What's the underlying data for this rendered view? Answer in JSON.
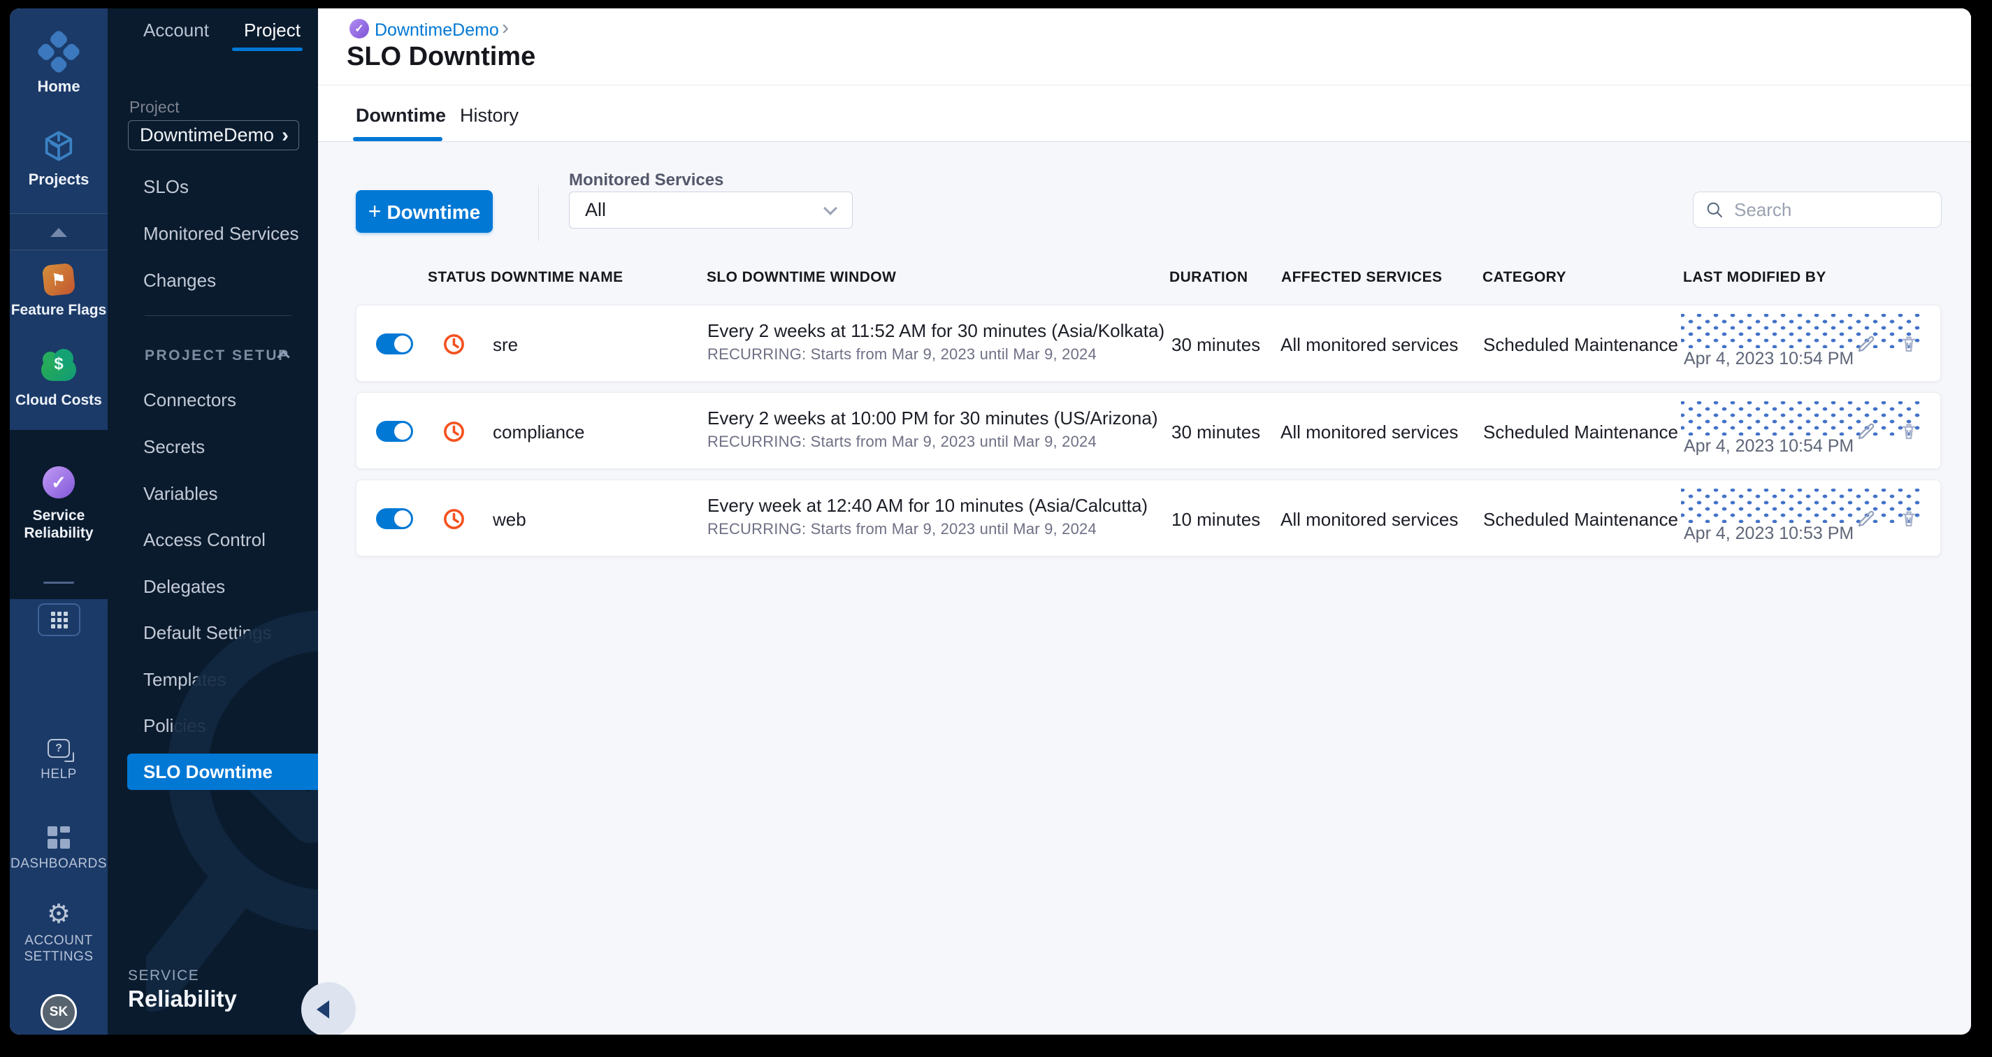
{
  "rail": {
    "top_items": [
      {
        "label": "Home"
      },
      {
        "label": "Projects"
      }
    ],
    "modules": [
      {
        "label": "Feature Flags"
      },
      {
        "label": "Cloud Costs"
      },
      {
        "label": "Service Reliability"
      }
    ],
    "bottom_items": [
      {
        "label": "HELP"
      },
      {
        "label": "DASHBOARDS"
      },
      {
        "label": "ACCOUNT SETTINGS"
      }
    ],
    "avatar_initials": "SK",
    "cloud_costs_symbol": "$",
    "flag_symbol": "⚑",
    "check_symbol": "✓",
    "help_symbol": "?",
    "gear_symbol": "⚙"
  },
  "sidebar": {
    "tabs": [
      {
        "label": "Account"
      },
      {
        "label": "Project"
      }
    ],
    "project_label": "Project",
    "project_value": "DowntimeDemo",
    "project_chevron": "›",
    "items": [
      {
        "label": "SLOs"
      },
      {
        "label": "Monitored Services"
      },
      {
        "label": "Changes"
      }
    ],
    "section_label": "PROJECT SETUP",
    "setup_items": [
      {
        "label": "Connectors"
      },
      {
        "label": "Secrets"
      },
      {
        "label": "Variables"
      },
      {
        "label": "Access Control"
      },
      {
        "label": "Delegates"
      },
      {
        "label": "Default Settings"
      },
      {
        "label": "Templates"
      },
      {
        "label": "Policies"
      },
      {
        "label": "SLO Downtime"
      }
    ],
    "footer_kicker": "SERVICE",
    "footer_name": "Reliability"
  },
  "header": {
    "breadcrumb_project": "DowntimeDemo",
    "breadcrumb_separator": "›",
    "breadcrumb_icon_glyph": "✓",
    "title": "SLO Downtime",
    "tabs": [
      {
        "label": "Downtime"
      },
      {
        "label": "History"
      }
    ]
  },
  "toolbar": {
    "plus": "+",
    "new_button_label": "Downtime",
    "filter_label": "Monitored Services",
    "filter_value": "All",
    "search_placeholder": "Search"
  },
  "table": {
    "columns": [
      "STATUS",
      "DOWNTIME NAME",
      "SLO DOWNTIME WINDOW",
      "DURATION",
      "AFFECTED SERVICES",
      "CATEGORY",
      "LAST MODIFIED BY"
    ],
    "rows": [
      {
        "enabled": true,
        "name": "sre",
        "window": "Every 2 weeks at 11:52 AM for 30 minutes (Asia/Kolkata)",
        "recurrence": "RECURRING: Starts from Mar 9, 2023 until Mar 9, 2024",
        "duration": "30 minutes",
        "affected": "All monitored services",
        "category": "Scheduled Maintenance",
        "modified": "Apr 4, 2023 10:54 PM"
      },
      {
        "enabled": true,
        "name": "compliance",
        "window": "Every 2 weeks at 10:00 PM for 30 minutes (US/Arizona)",
        "recurrence": "RECURRING: Starts from Mar 9, 2023 until Mar 9, 2024",
        "duration": "30 minutes",
        "affected": "All monitored services",
        "category": "Scheduled Maintenance",
        "modified": "Apr 4, 2023 10:54 PM"
      },
      {
        "enabled": true,
        "name": "web",
        "window": "Every week at 12:40 AM for 10 minutes (Asia/Calcutta)",
        "recurrence": "RECURRING: Starts from Mar 9, 2023 until Mar 9, 2024",
        "duration": "10 minutes",
        "affected": "All monitored services",
        "category": "Scheduled Maintenance",
        "modified": "Apr 4, 2023 10:53 PM"
      }
    ]
  },
  "colors": {
    "accent": "#0278d5",
    "rail_bg": "#1b3a68",
    "sidebar_bg": "#0a1b2e",
    "clock_icon": "#f4511e",
    "redact_dot": "#4272c8"
  }
}
